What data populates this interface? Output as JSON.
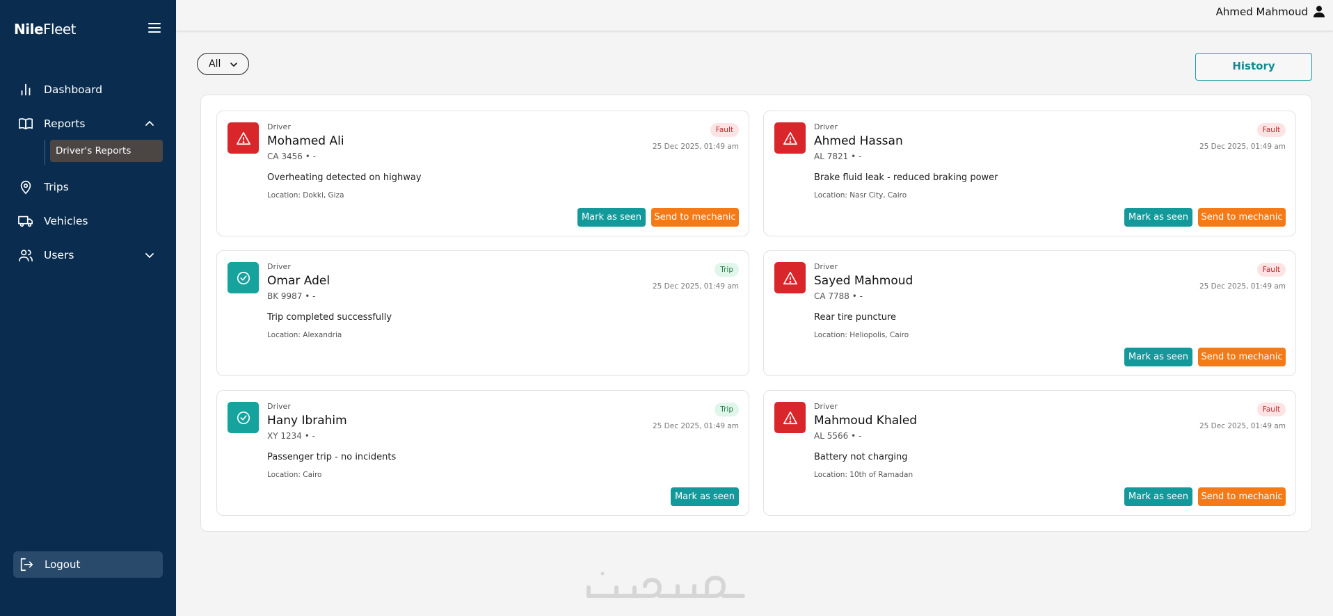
{
  "brand": {
    "bold": "Nile",
    "regular": "Fleet"
  },
  "sidebar": {
    "items": [
      {
        "label": "Dashboard"
      },
      {
        "label": "Reports"
      },
      {
        "label": "Trips"
      },
      {
        "label": "Vehicles"
      },
      {
        "label": "Users"
      }
    ],
    "sub_item": "Driver's Reports",
    "logout": "Logout"
  },
  "topbar": {
    "user_name": "Ahmed Mahmoud"
  },
  "filter": {
    "selected": "All"
  },
  "history_label": "History",
  "cards": [
    {
      "role": "Driver",
      "name": "Mohamed Ali",
      "plate": "CA 3456 • -",
      "desc": "Overheating detected on highway",
      "location": "Location: Dokki, Giza",
      "tag": "Fault",
      "time": "25 Dec 2025, 01:49 am",
      "seen": "Mark as seen",
      "mechanic": "Send to mechanic"
    },
    {
      "role": "Driver",
      "name": "Ahmed Hassan",
      "plate": "AL 7821 • -",
      "desc": "Brake fluid leak - reduced braking power",
      "location": "Location: Nasr City, Cairo",
      "tag": "Fault",
      "time": "25 Dec 2025, 01:49 am",
      "seen": "Mark as seen",
      "mechanic": "Send to mechanic"
    },
    {
      "role": "Driver",
      "name": "Omar Adel",
      "plate": "BK 9987 • -",
      "desc": "Trip completed successfully",
      "location": "Location: Alexandria",
      "tag": "Trip",
      "time": "25 Dec 2025, 01:49 am"
    },
    {
      "role": "Driver",
      "name": "Sayed Mahmoud",
      "plate": "CA 7788 • -",
      "desc": "Rear tire puncture",
      "location": "Location: Heliopolis, Cairo",
      "tag": "Fault",
      "time": "25 Dec 2025, 01:49 am",
      "seen": "Mark as seen",
      "mechanic": "Send to mechanic"
    },
    {
      "role": "Driver",
      "name": "Hany Ibrahim",
      "plate": "XY 1234 • -",
      "desc": "Passenger trip - no incidents",
      "location": "Location: Cairo",
      "tag": "Trip",
      "time": "25 Dec 2025, 01:49 am",
      "seen": "Mark as seen"
    },
    {
      "role": "Driver",
      "name": "Mahmoud Khaled",
      "plate": "AL 5566 • -",
      "desc": "Battery not charging",
      "location": "Location: 10th of Ramadan",
      "tag": "Fault",
      "time": "25 Dec 2025, 01:49 am",
      "seen": "Mark as seen",
      "mechanic": "Send to mechanic"
    }
  ],
  "watermark": "خمسات",
  "colors": {
    "sidebar": "#0a2d4f",
    "fault": "#d9262b",
    "trip": "#16a39d",
    "seen_button": "#14999b",
    "mechanic_button": "#f47a17"
  }
}
